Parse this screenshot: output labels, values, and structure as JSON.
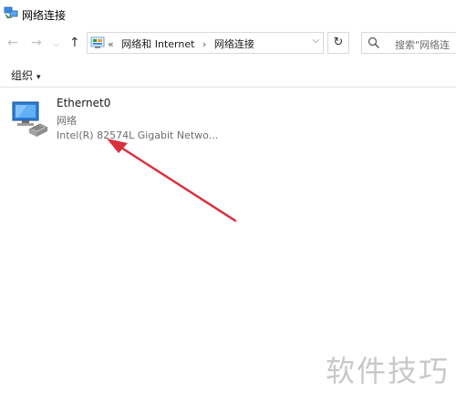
{
  "window": {
    "title": "网络连接"
  },
  "nav": {
    "back": "←",
    "forward": "→",
    "up": "↑"
  },
  "address": {
    "overflow": "«",
    "crumbs": [
      "网络和 Internet",
      "网络连接"
    ],
    "separator": "›",
    "dropdown": "⌵"
  },
  "refresh": {
    "label": "↻"
  },
  "search": {
    "placeholder": "搜索\"网络连"
  },
  "toolbar": {
    "organize_label": "组织",
    "caret": "▾"
  },
  "adapters": [
    {
      "name": "Ethernet0",
      "type": "网络",
      "device": "Intel(R) 82574L Gigabit Netwo..."
    }
  ],
  "watermark": {
    "text": "软件技巧"
  },
  "colors": {
    "arrow": "#d9303e",
    "border": "#d9d9d9",
    "monitor": "#2b7dd6"
  }
}
